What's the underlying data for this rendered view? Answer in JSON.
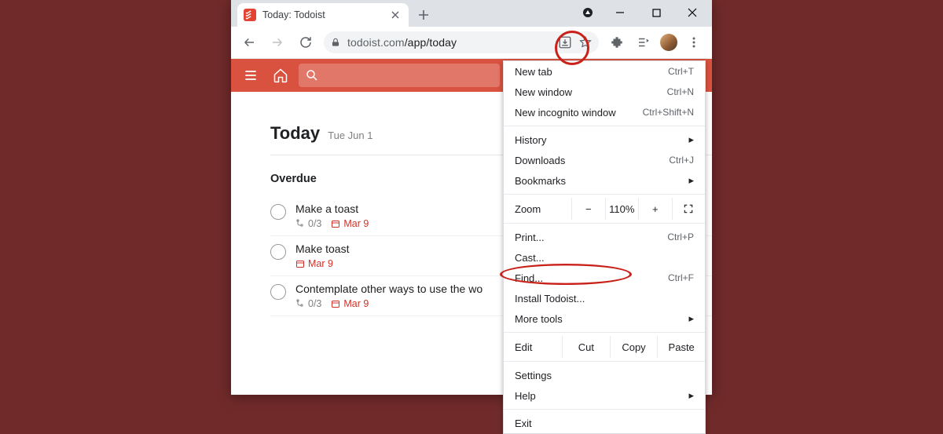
{
  "browser": {
    "tab_title": "Today: Todoist",
    "url_host": "todoist.com",
    "url_path": "/app/today"
  },
  "menu": {
    "new_tab": {
      "label": "New tab",
      "shortcut": "Ctrl+T"
    },
    "new_window": {
      "label": "New window",
      "shortcut": "Ctrl+N"
    },
    "new_incognito": {
      "label": "New incognito window",
      "shortcut": "Ctrl+Shift+N"
    },
    "history": {
      "label": "History"
    },
    "downloads": {
      "label": "Downloads",
      "shortcut": "Ctrl+J"
    },
    "bookmarks": {
      "label": "Bookmarks"
    },
    "zoom_label": "Zoom",
    "zoom_minus": "−",
    "zoom_value": "110%",
    "zoom_plus": "+",
    "print": {
      "label": "Print...",
      "shortcut": "Ctrl+P"
    },
    "cast": {
      "label": "Cast..."
    },
    "find": {
      "label": "Find...",
      "shortcut": "Ctrl+F"
    },
    "install": {
      "label": "Install Todoist..."
    },
    "more_tools": {
      "label": "More tools"
    },
    "edit_label": "Edit",
    "edit_cut": "Cut",
    "edit_copy": "Copy",
    "edit_paste": "Paste",
    "settings": {
      "label": "Settings"
    },
    "help": {
      "label": "Help"
    },
    "exit": {
      "label": "Exit"
    }
  },
  "app": {
    "heading": "Today",
    "heading_sub": "Tue Jun 1",
    "section_overdue": "Overdue",
    "tasks": [
      {
        "title": "Make a toast",
        "subtasks": "0/3",
        "date": "Mar 9"
      },
      {
        "title": "Make toast",
        "subtasks": "",
        "date": "Mar 9"
      },
      {
        "title": "Contemplate other ways to use the wo",
        "subtasks": "0/3",
        "date": "Mar 9"
      }
    ]
  }
}
